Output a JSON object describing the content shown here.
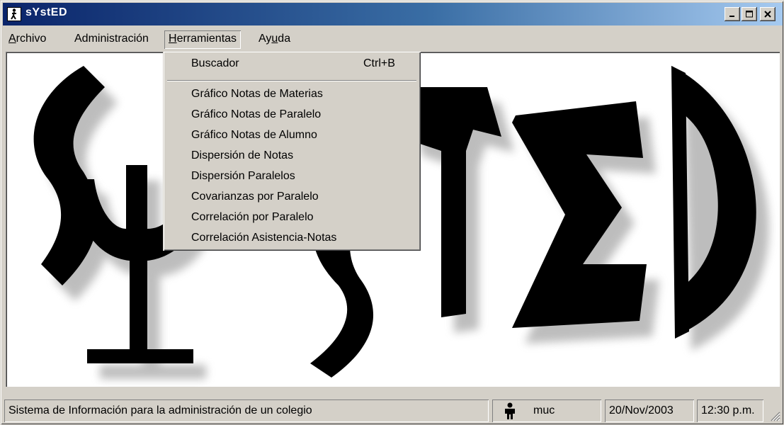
{
  "window": {
    "title": "sYstED",
    "controls": {
      "minimize": "minimize-icon",
      "maximize": "maximize-icon",
      "close": "close-icon"
    }
  },
  "menubar": {
    "items": [
      {
        "label": "Archivo",
        "mnemonic": "A",
        "rest": "rchivo"
      },
      {
        "label": "Administración",
        "mnemonic": "",
        "rest": "Administración"
      },
      {
        "label": "Herramientas",
        "mnemonic": "H",
        "rest": "erramientas"
      },
      {
        "label": "Ayuda",
        "pre": "Ay",
        "mnemonic": "u",
        "rest": "da"
      }
    ]
  },
  "dropdown": {
    "items": [
      {
        "label": "Buscador",
        "shortcut": "Ctrl+B"
      },
      {
        "label": "Gráfico Notas de Materias"
      },
      {
        "label": "Gráfico Notas de Paralelo"
      },
      {
        "label": "Gráfico Notas de Alumno"
      },
      {
        "label": "Dispersión de Notas"
      },
      {
        "label": "Dispersión Paralelos"
      },
      {
        "label": "Covarianzas por Paralelo"
      },
      {
        "label": "Correlación por Paralelo"
      },
      {
        "label": "Correlación Asistencia-Notas"
      }
    ]
  },
  "statusbar": {
    "description": "Sistema de Información para la administración de un colegio",
    "user_icon": "user-icon",
    "user": "muc",
    "date": "20/Nov/2003",
    "time": "12:30 p.m."
  },
  "logo": {
    "text": "sYstED",
    "icon": "systed-logo"
  }
}
